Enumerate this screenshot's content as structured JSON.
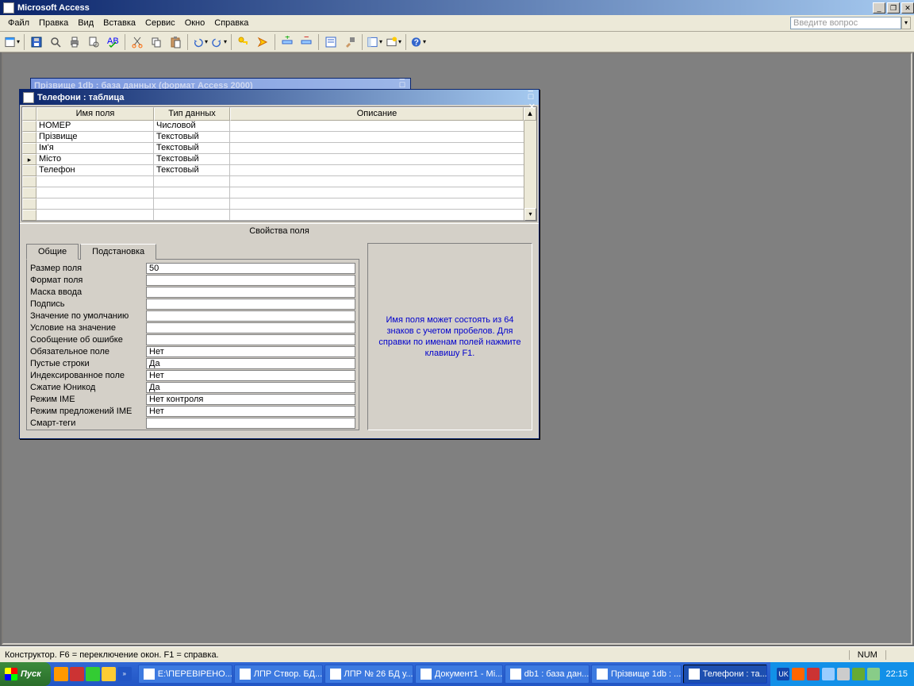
{
  "app": {
    "title": "Microsoft Access"
  },
  "menubar": {
    "items": [
      "Файл",
      "Правка",
      "Вид",
      "Вставка",
      "Сервис",
      "Окно",
      "Справка"
    ],
    "ask_placeholder": "Введите вопрос"
  },
  "mdi_back": {
    "title": "Прізвище 1db : база данных (формат Access 2000)"
  },
  "designer": {
    "title": "Телефони : таблица",
    "columns": {
      "name": "Имя поля",
      "type": "Тип данных",
      "desc": "Описание"
    },
    "rows": [
      {
        "name": "НОМЕР",
        "type": "Числовой",
        "desc": "",
        "current": false
      },
      {
        "name": "Прізвище",
        "type": "Текстовый",
        "desc": "",
        "current": false
      },
      {
        "name": "Ім'я",
        "type": "Текстовый",
        "desc": "",
        "current": false
      },
      {
        "name": "Місто",
        "type": "Текстовый",
        "desc": "",
        "current": true
      },
      {
        "name": "Телефон",
        "type": "Текстовый",
        "desc": "",
        "current": false
      },
      {
        "name": "",
        "type": "",
        "desc": "",
        "current": false
      },
      {
        "name": "",
        "type": "",
        "desc": "",
        "current": false
      },
      {
        "name": "",
        "type": "",
        "desc": "",
        "current": false
      },
      {
        "name": "",
        "type": "",
        "desc": "",
        "current": false
      }
    ],
    "props_title": "Свойства поля",
    "tabs": {
      "general": "Общие",
      "lookup": "Подстановка"
    },
    "properties": [
      {
        "label": "Размер поля",
        "value": "50"
      },
      {
        "label": "Формат поля",
        "value": ""
      },
      {
        "label": "Маска ввода",
        "value": ""
      },
      {
        "label": "Подпись",
        "value": ""
      },
      {
        "label": "Значение по умолчанию",
        "value": ""
      },
      {
        "label": "Условие на значение",
        "value": ""
      },
      {
        "label": "Сообщение об ошибке",
        "value": ""
      },
      {
        "label": "Обязательное поле",
        "value": "Нет"
      },
      {
        "label": "Пустые строки",
        "value": "Да"
      },
      {
        "label": "Индексированное поле",
        "value": "Нет"
      },
      {
        "label": "Сжатие Юникод",
        "value": "Да"
      },
      {
        "label": "Режим IME",
        "value": "Нет контроля"
      },
      {
        "label": "Режим предложений IME",
        "value": "Нет"
      },
      {
        "label": "Смарт-теги",
        "value": ""
      }
    ],
    "help_text": "Имя поля может состоять из 64 знаков с учетом пробелов.  Для справки по именам полей нажмите клавишу F1."
  },
  "statusbar": {
    "text": "Конструктор.  F6 = переключение окон.  F1 = справка.",
    "num": "NUM"
  },
  "taskbar": {
    "start": "Пуск",
    "tasks": [
      {
        "label": "E:\\ПЕРЕВІРЕНО..."
      },
      {
        "label": "ЛПР Створ. БД..."
      },
      {
        "label": "ЛПР № 26 БД у..."
      },
      {
        "label": "Документ1 - Mi..."
      },
      {
        "label": "db1 : база дан..."
      },
      {
        "label": "Прізвище 1db : ..."
      },
      {
        "label": "Телефони : та...",
        "active": true
      }
    ],
    "lang": "UK",
    "clock": "22:15"
  }
}
